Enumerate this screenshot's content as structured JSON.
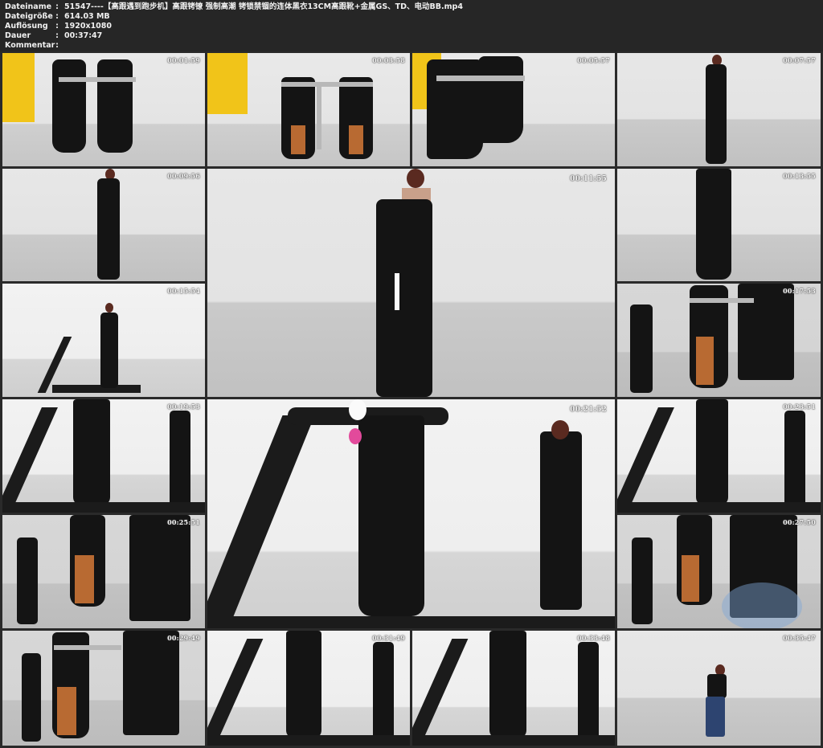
{
  "header": {
    "rows": [
      {
        "key": "Dateiname",
        "value": "51547----【高跟遇到跑步机】高跟铐镣 强制高潮 铐锁禁锢的连体黑衣13CM高跟靴+金属GS、TD、电动BB.mp4"
      },
      {
        "key": "Dateigröße",
        "value": "614.03 MB"
      },
      {
        "key": "Auflösung",
        "value": "1920x1080"
      },
      {
        "key": "Dauer",
        "value": "00:37:47"
      },
      {
        "key": "Kommentar",
        "value": ""
      }
    ],
    "separator": ":"
  },
  "thumbnails": [
    {
      "timestamp": "00:01:59"
    },
    {
      "timestamp": "00:03:58"
    },
    {
      "timestamp": "00:05:57"
    },
    {
      "timestamp": "00:07:57"
    },
    {
      "timestamp": "00:09:56"
    },
    {
      "timestamp": "00:11:55"
    },
    {
      "timestamp": "00:13:55"
    },
    {
      "timestamp": "00:15:54"
    },
    {
      "timestamp": "00:17:53"
    },
    {
      "timestamp": "00:19:53"
    },
    {
      "timestamp": "00:21:52"
    },
    {
      "timestamp": "00:23:51"
    },
    {
      "timestamp": "00:25:51"
    },
    {
      "timestamp": "00:27:50"
    },
    {
      "timestamp": "00:29:49"
    },
    {
      "timestamp": "00:31:49"
    },
    {
      "timestamp": "00:33:48"
    },
    {
      "timestamp": "00:35:47"
    }
  ]
}
